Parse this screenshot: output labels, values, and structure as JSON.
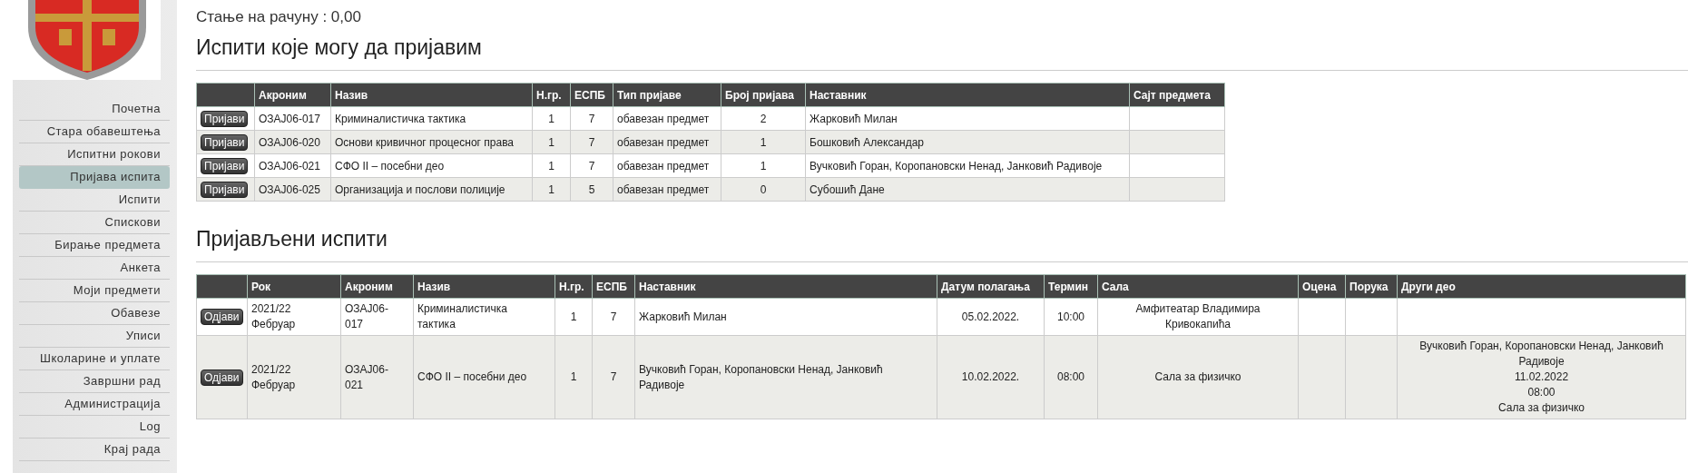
{
  "sidebar": {
    "items": [
      {
        "label": "Почетна",
        "selected": false
      },
      {
        "label": "Стара обавештења",
        "selected": false
      },
      {
        "label": "Испитни рокови",
        "selected": false
      },
      {
        "label": "Пријава испита",
        "selected": true
      },
      {
        "label": "Испити",
        "selected": false
      },
      {
        "label": "Спискови",
        "selected": false
      },
      {
        "label": "Бирање предмета",
        "selected": false
      },
      {
        "label": "Анкета",
        "selected": false
      },
      {
        "label": "Моји предмети",
        "selected": false
      },
      {
        "label": "Обавезе",
        "selected": false
      },
      {
        "label": "Уписи",
        "selected": false
      },
      {
        "label": "Школарине и уплате",
        "selected": false
      },
      {
        "label": "Завршни рад",
        "selected": false
      },
      {
        "label": "Администрација",
        "selected": false
      },
      {
        "label": "Log",
        "selected": false
      },
      {
        "label": "Крај рада",
        "selected": false
      }
    ]
  },
  "balance": "Стање на рачуну : 0,00",
  "available": {
    "title": "Испити које могу да пријавим",
    "columns": [
      "Акроним",
      "Назив",
      "Н.гр.",
      "ЕСПБ",
      "Тип пријаве",
      "Број пријава",
      "Наставник",
      "Сајт предмета"
    ],
    "rows": [
      {
        "button": "Пријави",
        "cells": [
          "ОЗАЈ06-017",
          "Криминалистичка тактика",
          "1",
          "7",
          "обавезан предмет",
          "2",
          "Жарковић Милан",
          ""
        ]
      },
      {
        "button": "Пријави",
        "cells": [
          "ОЗАЈ06-020",
          "Основи кривичног процесног права",
          "1",
          "7",
          "обавезан предмет",
          "1",
          "Бошковић Александар",
          ""
        ]
      },
      {
        "button": "Пријави",
        "cells": [
          "ОЗАЈ06-021",
          "СФО II – посебни део",
          "1",
          "7",
          "обавезан предмет",
          "1",
          "Вучковић Горан, Коропановски Ненад, Јанковић Радивоје",
          ""
        ]
      },
      {
        "button": "Пријави",
        "cells": [
          "ОЗАЈ06-025",
          "Организација и послови полиције",
          "1",
          "5",
          "обавезан предмет",
          "0",
          "Субошић Дане",
          ""
        ]
      }
    ]
  },
  "registered": {
    "title": "Пријављени испити",
    "columns": [
      "Рок",
      "Акроним",
      "Назив",
      "Н.гр.",
      "ЕСПБ",
      "Наставник",
      "Датум полагања",
      "Термин",
      "Сала",
      "Оцена",
      "Порука",
      "Други део"
    ],
    "rows": [
      {
        "button": "Одјави",
        "cells": [
          [
            "2021/22",
            "Фебруар"
          ],
          [
            "ОЗАЈ06-",
            "017"
          ],
          [
            "Криминалистичка",
            "тактика"
          ],
          [
            "1"
          ],
          [
            "7"
          ],
          [
            "Жарковић Милан"
          ],
          [
            "05.02.2022."
          ],
          [
            "10:00"
          ],
          [
            "Амфитеатар Владимира",
            "Кривокапића"
          ],
          [],
          [],
          []
        ]
      },
      {
        "button": "Одјави",
        "cells": [
          [
            "2021/22",
            "Фебруар"
          ],
          [
            "ОЗАЈ06-",
            "021"
          ],
          [
            "СФО II – посебни део"
          ],
          [
            "1"
          ],
          [
            "7"
          ],
          [
            "Вучковић Горан, Коропановски Ненад, Јанковић",
            "Радивоје"
          ],
          [
            "10.02.2022."
          ],
          [
            "08:00"
          ],
          [
            "Сала за физичко"
          ],
          [],
          [],
          [
            "Вучковић Горан, Коропановски Ненад, Јанковић",
            "Радивоје",
            "11.02.2022",
            "08:00",
            "Сала за физичко"
          ]
        ]
      }
    ]
  }
}
